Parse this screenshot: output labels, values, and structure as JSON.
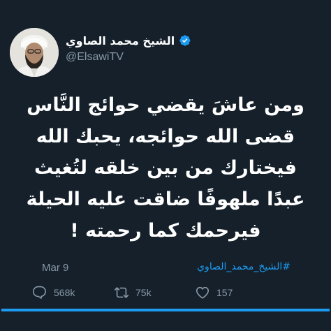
{
  "author": {
    "name": "الشيخ محمد الصاوي",
    "handle": "@ElsawiTV",
    "verified_icon": "verified-badge-icon"
  },
  "tweet": {
    "lines": [
      "ومن عاشَ يقضي حوائج النَّاس",
      "قضى الله حوائجه، يحبك الله",
      "فيختارك من بين خلقه لتُغيث",
      "عبدًا ملهوفًا ضاقت عليه الحيلة",
      "فيرحمك كما رحمته !"
    ]
  },
  "meta": {
    "date": "Mar 9",
    "hashtag": "#الشيخ_محمد_الصاوي"
  },
  "actions": {
    "replies": "568k",
    "retweets": "75k",
    "likes": "157"
  },
  "colors": {
    "background": "#15202b",
    "accent": "#1d9bf0",
    "muted": "#8899a6"
  }
}
